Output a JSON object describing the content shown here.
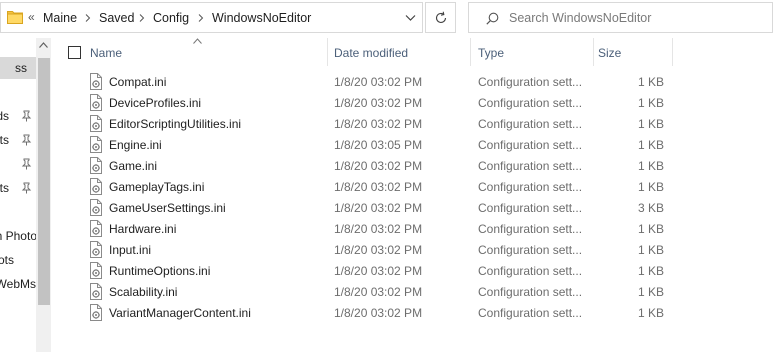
{
  "address_bar": {
    "overflow_chevron": "«",
    "crumbs": [
      "Maine",
      "Saved",
      "Config",
      "WindowsNoEditor"
    ]
  },
  "search": {
    "placeholder": "Search WindowsNoEditor"
  },
  "nav_pane": {
    "items": [
      {
        "label": "ss",
        "selected": true,
        "pinned": false
      },
      {
        "label": "ds",
        "selected": false,
        "pinned": true
      },
      {
        "label": "ts",
        "selected": false,
        "pinned": true
      },
      {
        "label": "",
        "selected": false,
        "pinned": true
      },
      {
        "label": "ots",
        "selected": false,
        "pinned": true
      },
      {
        "label": "n Photo",
        "selected": false,
        "pinned": false
      },
      {
        "label": "ots",
        "selected": false,
        "pinned": false
      },
      {
        "label": "WebMs",
        "selected": false,
        "pinned": false
      }
    ]
  },
  "columns": {
    "name": "Name",
    "date": "Date modified",
    "type": "Type",
    "size": "Size"
  },
  "files": [
    {
      "name": "Compat.ini",
      "date": "1/8/20 03:02 PM",
      "type": "Configuration sett...",
      "size": "1 KB"
    },
    {
      "name": "DeviceProfiles.ini",
      "date": "1/8/20 03:02 PM",
      "type": "Configuration sett...",
      "size": "1 KB"
    },
    {
      "name": "EditorScriptingUtilities.ini",
      "date": "1/8/20 03:02 PM",
      "type": "Configuration sett...",
      "size": "1 KB"
    },
    {
      "name": "Engine.ini",
      "date": "1/8/20 03:05 PM",
      "type": "Configuration sett...",
      "size": "1 KB"
    },
    {
      "name": "Game.ini",
      "date": "1/8/20 03:02 PM",
      "type": "Configuration sett...",
      "size": "1 KB"
    },
    {
      "name": "GameplayTags.ini",
      "date": "1/8/20 03:02 PM",
      "type": "Configuration sett...",
      "size": "1 KB"
    },
    {
      "name": "GameUserSettings.ini",
      "date": "1/8/20 03:02 PM",
      "type": "Configuration sett...",
      "size": "3 KB"
    },
    {
      "name": "Hardware.ini",
      "date": "1/8/20 03:02 PM",
      "type": "Configuration sett...",
      "size": "1 KB"
    },
    {
      "name": "Input.ini",
      "date": "1/8/20 03:02 PM",
      "type": "Configuration sett...",
      "size": "1 KB"
    },
    {
      "name": "RuntimeOptions.ini",
      "date": "1/8/20 03:02 PM",
      "type": "Configuration sett...",
      "size": "1 KB"
    },
    {
      "name": "Scalability.ini",
      "date": "1/8/20 03:02 PM",
      "type": "Configuration sett...",
      "size": "1 KB"
    },
    {
      "name": "VariantManagerContent.ini",
      "date": "1/8/20 03:02 PM",
      "type": "Configuration sett...",
      "size": "1 KB"
    }
  ],
  "icons": {
    "folder": "folder-icon",
    "file": "ini-file-icon",
    "pin": "pin-icon",
    "refresh": "refresh-icon",
    "search": "search-icon"
  },
  "colors": {
    "folder_yellow": "#f5c343",
    "header_text": "#4c607a",
    "selected_nav": "#d9d9d9"
  }
}
